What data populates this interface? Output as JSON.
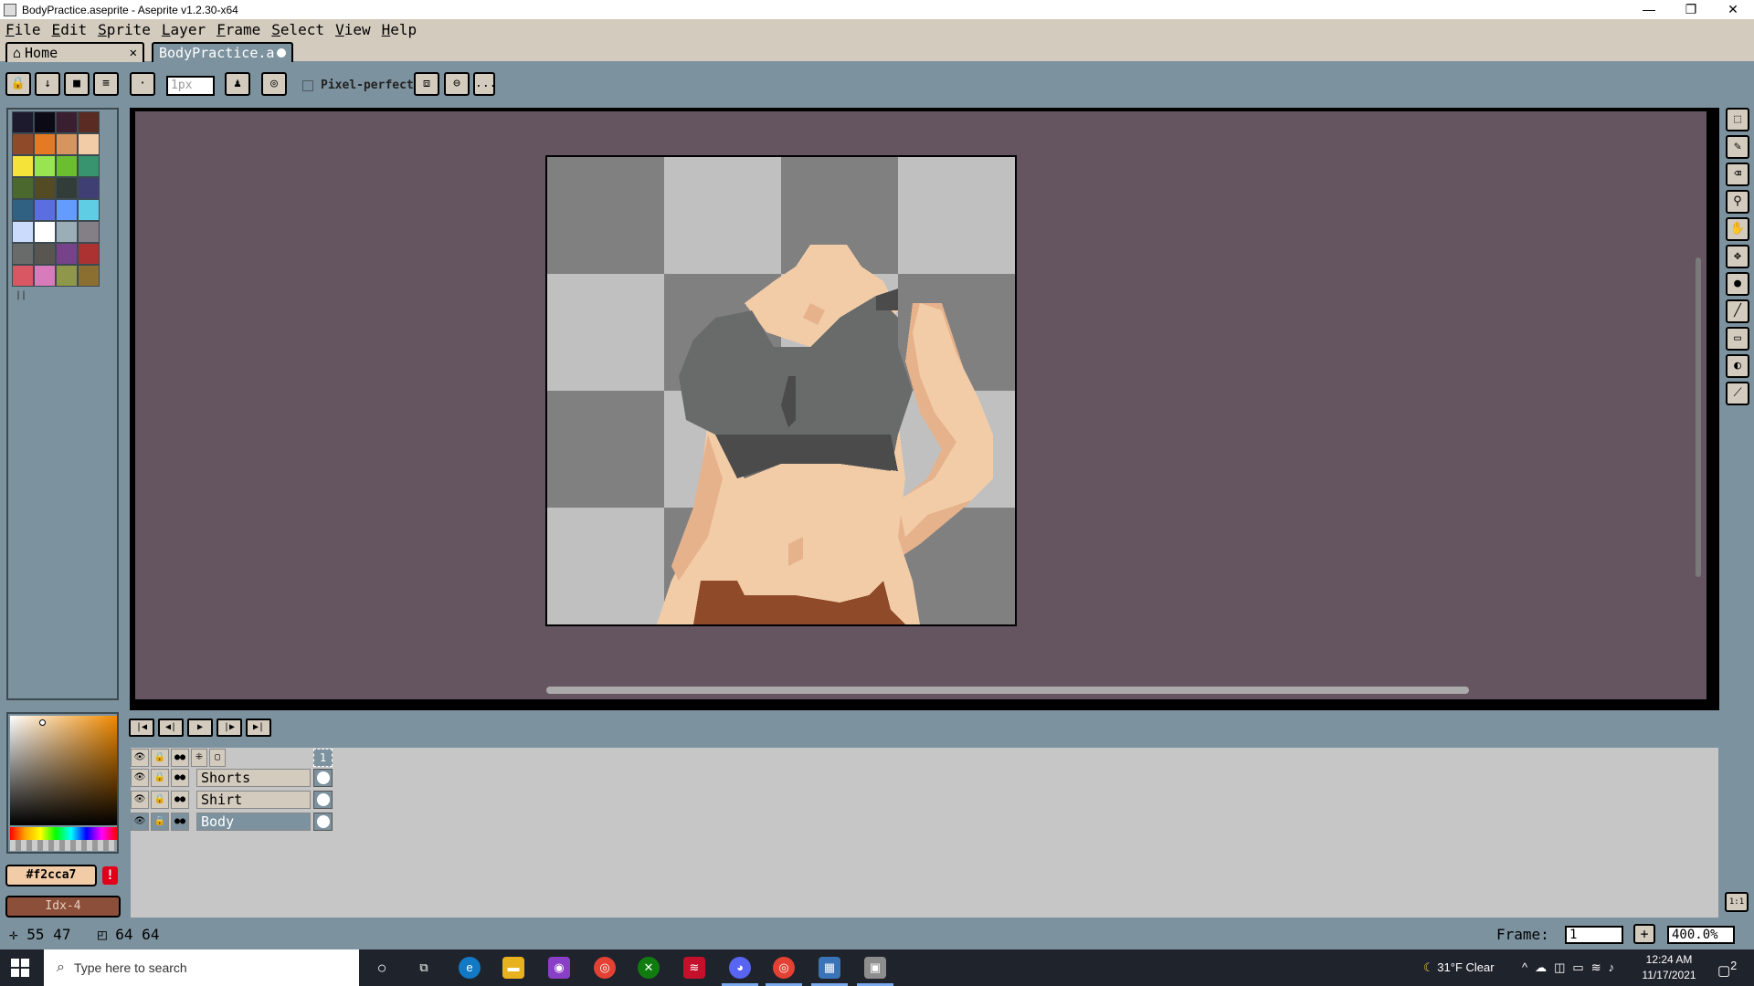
{
  "window": {
    "title": "BodyPractice.aseprite - Aseprite v1.2.30-x64",
    "minimize": "—",
    "maximize": "❐",
    "close": "✕"
  },
  "menu": [
    "File",
    "Edit",
    "Sprite",
    "Layer",
    "Frame",
    "Select",
    "View",
    "Help"
  ],
  "tabs": {
    "home_label": "Home",
    "file_label": "BodyPractice.a"
  },
  "contextbar": {
    "brush_size": "1px",
    "pixel_perfect_label": "Pixel-perfect",
    "more_label": "..."
  },
  "palette": [
    "#1c1a2c",
    "#0c0a14",
    "#3a1f30",
    "#5a2b22",
    "#8f4a2a",
    "#e57a25",
    "#d7955e",
    "#f2cca7",
    "#f5e339",
    "#99e550",
    "#6abe30",
    "#37946e",
    "#4b692f",
    "#524b24",
    "#323c39",
    "#3f3f74",
    "#306082",
    "#5b6ee1",
    "#639bff",
    "#5fcde4",
    "#cbdbfc",
    "#ffffff",
    "#9badb7",
    "#847e87",
    "#696a6a",
    "#595652",
    "#76428a",
    "#ac3232",
    "#d95763",
    "#d77bba",
    "#8f974a",
    "#8a6f30"
  ],
  "colors": {
    "fg_hex": "#f2cca7",
    "fg_label": "#f2cca7",
    "bg_label": "Idx-4",
    "bg_hex": "#8b4f3a",
    "accent": "#7d929f"
  },
  "layers": [
    {
      "name": "Shorts"
    },
    {
      "name": "Shirt"
    },
    {
      "name": "Body",
      "active": true
    }
  ],
  "timeline": {
    "frame_header": "1"
  },
  "status": {
    "cursor_pos": "55 47",
    "sprite_size": "64 64",
    "frame_label": "Frame:",
    "frame_value": "1",
    "zoom": "400.0%"
  },
  "taskbar": {
    "search_placeholder": "Type here to search",
    "weather": "31°F  Clear",
    "time": "12:24 AM",
    "date": "11/17/2021",
    "notifications": "2"
  }
}
